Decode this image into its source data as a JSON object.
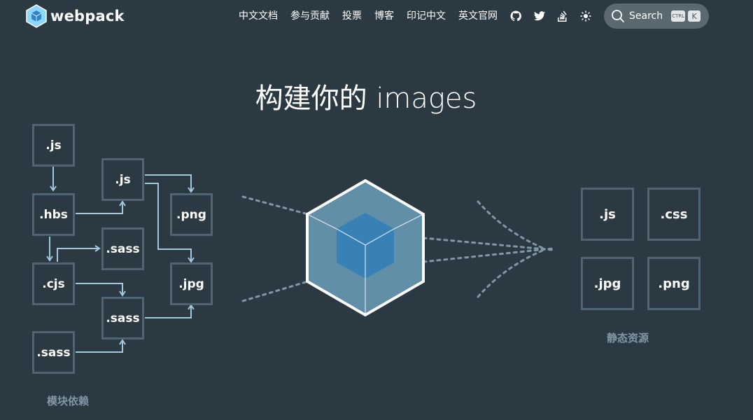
{
  "header": {
    "brand": "webpack",
    "nav": [
      {
        "label": "中文文档"
      },
      {
        "label": "参与贡献"
      },
      {
        "label": "投票"
      },
      {
        "label": "博客"
      },
      {
        "label": "印记中文"
      },
      {
        "label": "英文官网"
      }
    ],
    "icons": [
      "github-icon",
      "twitter-icon",
      "stack-overflow-icon",
      "theme-toggle-icon"
    ],
    "search": {
      "label": "Search",
      "shortcut_ctrl": "CTRL",
      "shortcut_key": "K"
    }
  },
  "hero": {
    "headline": "构建你的 images"
  },
  "dependencies": {
    "caption": "模块依赖",
    "modules": [
      ".js",
      ".hbs",
      ".js",
      ".png",
      ".sass",
      ".cjs",
      ".jpg",
      ".sass",
      ".sass"
    ]
  },
  "assets": {
    "caption": "静态资源",
    "files": [
      ".js",
      ".css",
      ".jpg",
      ".png"
    ]
  },
  "colors": {
    "background": "#2b3a42",
    "box_border": "#4f6370",
    "connector": "#a6c8dd",
    "cube_outer": "#8ed6fb",
    "cube_inner": "#1c78c0"
  }
}
